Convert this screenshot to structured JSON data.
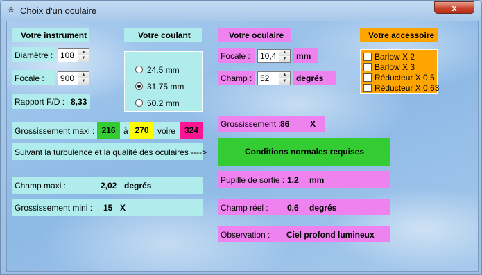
{
  "window": {
    "title": "Choix d'un oculaire",
    "close_label": "x",
    "icon_glyph": "※"
  },
  "instrument": {
    "header": "Votre instrument",
    "diameter_label": "Diamètre :",
    "diameter_value": "108",
    "focal_label": "Focale :",
    "focal_value": "900",
    "ratio_label": "Rapport F/D :",
    "ratio_value": "8,33",
    "max_mag_label": "Grossissement maxi :",
    "max_mag_from": "216",
    "max_mag_to_word": "à",
    "max_mag_to": "270",
    "max_mag_or_word": "voire",
    "max_mag_extra": "324",
    "turbulence_note": "Suivant la turbulence et la qualité des oculaires  ---->",
    "max_field_label": "Champ maxi :",
    "max_field_value": "2,02",
    "max_field_unit": "degrés",
    "min_mag_label": "Grossissement mini :",
    "min_mag_value": "15",
    "min_mag_unit": "X"
  },
  "coulant": {
    "header": "Votre coulant",
    "options": [
      "24.5 mm",
      "31.75 mm",
      "50.2 mm"
    ],
    "selected": "31.75 mm"
  },
  "oculaire": {
    "header": "Votre oculaire",
    "focal_label": "Focale :",
    "focal_value": "10,4",
    "focal_unit": "mm",
    "field_label": "Champ :",
    "field_value": "52",
    "field_unit": "degrés",
    "mag_label": "Grossissement :",
    "mag_value": "86",
    "mag_unit": "X",
    "conditions": "Conditions normales requises",
    "pupil_label": "Pupille de sortie :",
    "pupil_value": "1,2",
    "pupil_unit": "mm",
    "real_field_label": "Champ réel :",
    "real_field_value": "0,6",
    "real_field_unit": "degrés",
    "observation_label": "Observation :",
    "observation_value": "Ciel profond lumineux"
  },
  "accessoire": {
    "header": "Votre accessoire",
    "items": [
      "Barlow X 2",
      "Barlow X 3",
      "Réducteur X 0.5",
      "Réducteur X 0.63"
    ]
  },
  "colors": {
    "cyan": "#b0ecec",
    "pink": "#ee82ee",
    "orange": "#ffa500",
    "green": "#33cc33",
    "yellow": "#ffff00",
    "magenta": "#ff1493"
  }
}
